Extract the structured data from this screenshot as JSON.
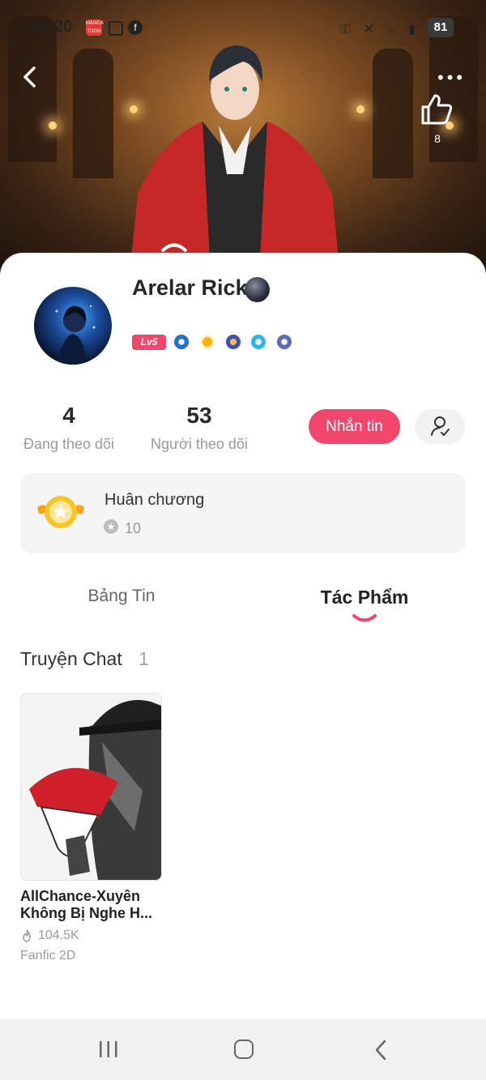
{
  "status_bar": {
    "time": "23:20",
    "battery": "81",
    "app_badge_text": "MANGA TOON"
  },
  "header": {
    "like_count": "8",
    "more_label": "•••"
  },
  "profile": {
    "name": "Arelar Rick",
    "level": "Lv5"
  },
  "stats": {
    "following_count": "4",
    "following_label": "Đang theo dõi",
    "followers_count": "53",
    "followers_label": "Người theo dõi"
  },
  "actions": {
    "message_label": "Nhắn tin"
  },
  "medal_card": {
    "title": "Huân chương",
    "count": "10"
  },
  "tabs": [
    {
      "label": "Bảng Tin",
      "active": false
    },
    {
      "label": "Tác Phẩm",
      "active": true
    }
  ],
  "section": {
    "title": "Truyện Chat",
    "count": "1"
  },
  "works": [
    {
      "title": "AllChance-Xuyên Không Bị Nghe H...",
      "views": "104.5K",
      "genre": "Fanfic 2D"
    }
  ],
  "colors": {
    "accent": "#f3466d",
    "level_badge": "#f0476a",
    "card_bg": "#f5f5f5",
    "muted_text": "#9a9a9a"
  },
  "icons": {
    "back": "back-arrow-icon",
    "more": "more-dots-icon",
    "like": "thumbs-up-icon",
    "follow": "add-person-icon",
    "medal": "medal-icon",
    "star": "star-icon",
    "views": "fire-icon",
    "nav_recent": "recent-apps-icon",
    "nav_home": "home-icon",
    "nav_back": "nav-back-icon"
  }
}
